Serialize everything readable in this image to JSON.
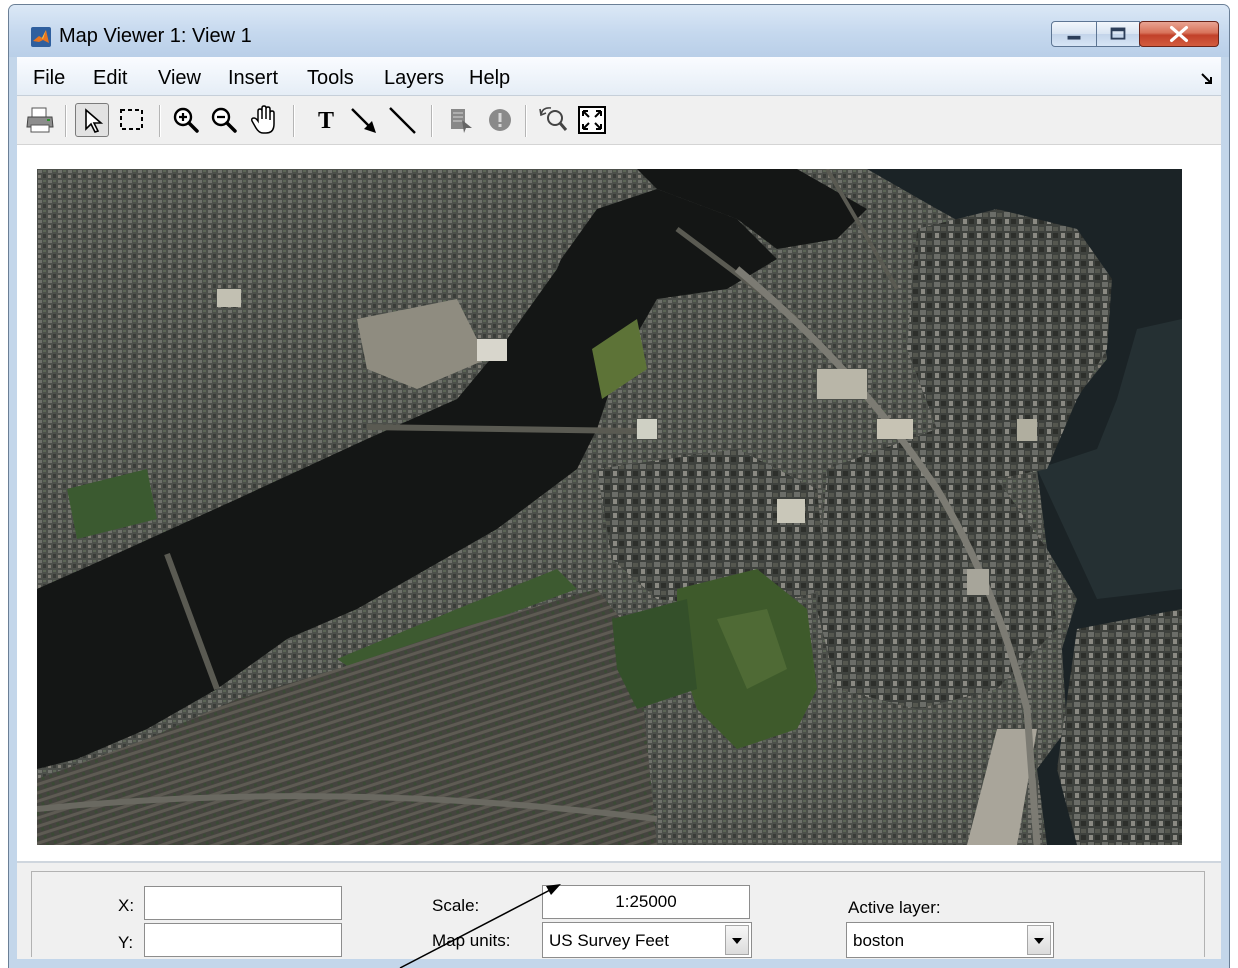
{
  "window": {
    "title": "Map Viewer 1: View 1",
    "title_color": "#000000",
    "close_color": "#c7432b"
  },
  "menu": {
    "items": [
      "File",
      "Edit",
      "View",
      "Insert",
      "Tools",
      "Layers",
      "Help"
    ]
  },
  "toolbar": {
    "tools": [
      {
        "name": "print-icon"
      },
      {
        "name": "select-arrow-icon",
        "active": true
      },
      {
        "name": "select-area-icon"
      },
      {
        "name": "zoom-in-icon"
      },
      {
        "name": "zoom-out-icon"
      },
      {
        "name": "pan-hand-icon"
      },
      {
        "name": "insert-text-icon"
      },
      {
        "name": "insert-arrow-icon"
      },
      {
        "name": "insert-line-icon"
      },
      {
        "name": "datatip-icon"
      },
      {
        "name": "info-icon"
      },
      {
        "name": "prev-view-icon"
      },
      {
        "name": "fit-to-window-icon"
      }
    ]
  },
  "panel": {
    "x_label": "X:",
    "x_value": "",
    "y_label": "Y:",
    "y_value": "",
    "scale_label": "Scale:",
    "scale_value": "1:25000",
    "map_units_label": "Map units:",
    "map_units_value": "US Survey Feet",
    "active_layer_label": "Active layer:",
    "active_layer_value": "boston"
  }
}
